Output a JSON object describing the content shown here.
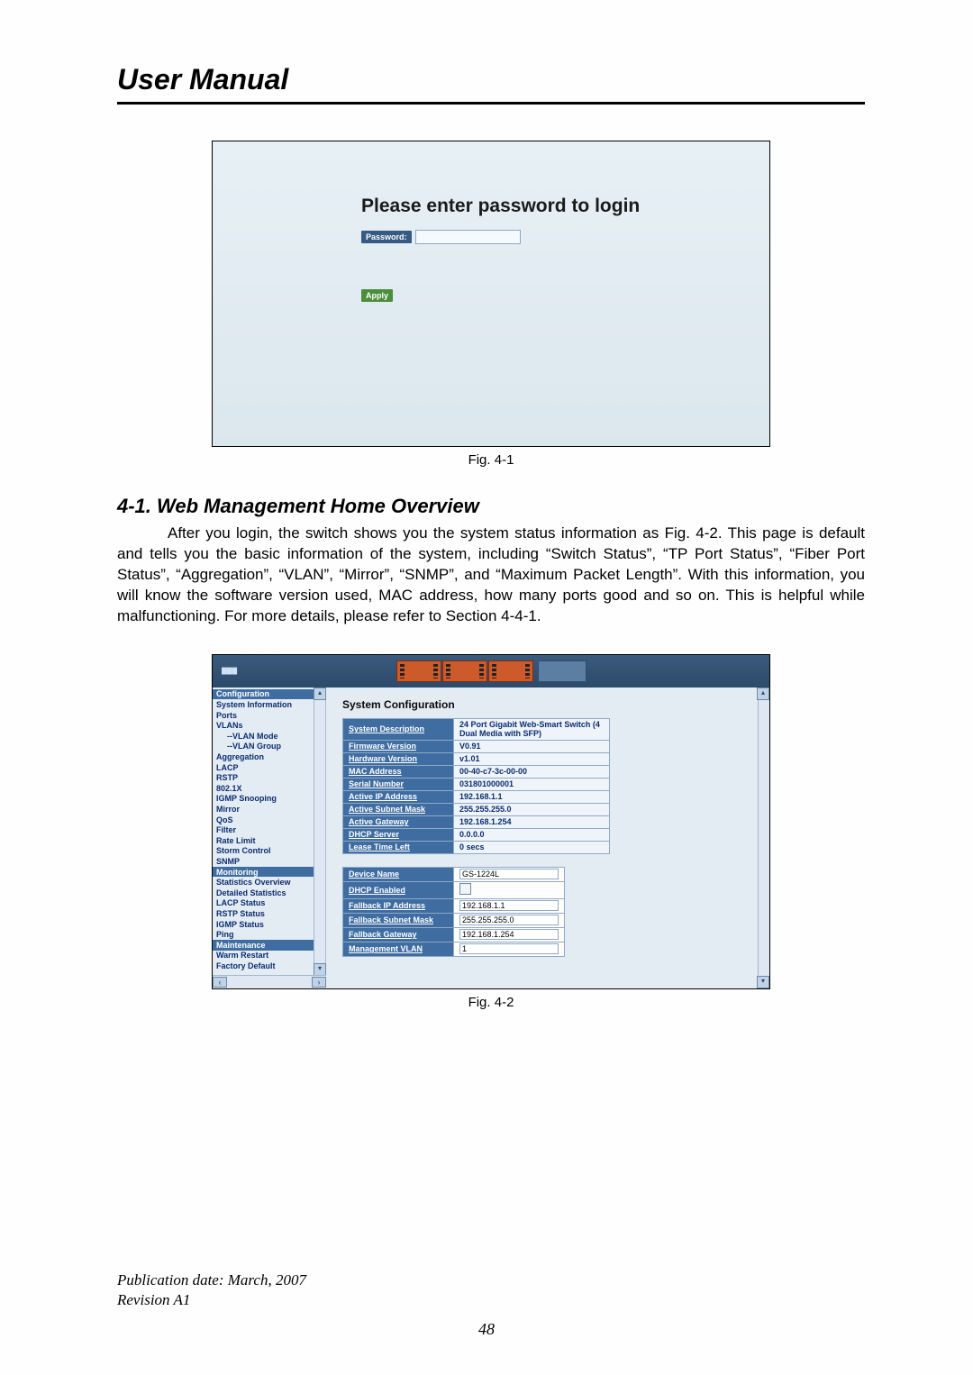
{
  "doc_title": "User Manual",
  "fig1": {
    "caption": "Fig. 4-1",
    "headline": "Please enter password to login",
    "password_label": "Password:",
    "apply_label": "Apply"
  },
  "section_heading": "4-1. Web Management Home Overview",
  "body_paragraph": "After you login, the switch shows you the system status information as Fig. 4-2. This page is default and tells you the basic information of the system, including “Switch Status”, “TP Port Status”, “Fiber Port Status”, “Aggregation”, “VLAN”, “Mirror”, “SNMP”, and “Maximum Packet Length”. With this information, you will know the software version used, MAC address, how many ports good and so on. This is helpful while malfunctioning. For more details, please refer to Section 4-4-1.",
  "fig2": {
    "caption": "Fig. 4-2",
    "panel_title": "System Configuration",
    "sidebar": [
      {
        "label": "Configuration",
        "cls": "header"
      },
      {
        "label": "System Information",
        "cls": ""
      },
      {
        "label": "Ports",
        "cls": ""
      },
      {
        "label": "VLANs",
        "cls": ""
      },
      {
        "label": "--VLAN Mode",
        "cls": "indent"
      },
      {
        "label": "--VLAN Group",
        "cls": "indent"
      },
      {
        "label": "Aggregation",
        "cls": ""
      },
      {
        "label": "LACP",
        "cls": ""
      },
      {
        "label": "RSTP",
        "cls": ""
      },
      {
        "label": "802.1X",
        "cls": ""
      },
      {
        "label": "IGMP Snooping",
        "cls": ""
      },
      {
        "label": "Mirror",
        "cls": ""
      },
      {
        "label": "QoS",
        "cls": ""
      },
      {
        "label": "Filter",
        "cls": ""
      },
      {
        "label": "Rate Limit",
        "cls": ""
      },
      {
        "label": "Storm Control",
        "cls": ""
      },
      {
        "label": "SNMP",
        "cls": ""
      },
      {
        "label": "Monitoring",
        "cls": "header"
      },
      {
        "label": "Statistics Overview",
        "cls": ""
      },
      {
        "label": "Detailed Statistics",
        "cls": ""
      },
      {
        "label": "LACP Status",
        "cls": ""
      },
      {
        "label": "RSTP Status",
        "cls": ""
      },
      {
        "label": "IGMP Status",
        "cls": ""
      },
      {
        "label": "Ping",
        "cls": ""
      },
      {
        "label": "Maintenance",
        "cls": "header"
      },
      {
        "label": "Warm Restart",
        "cls": ""
      },
      {
        "label": "Factory Default",
        "cls": ""
      }
    ],
    "table1": [
      {
        "k": "System Description",
        "v": "24 Port Gigabit Web-Smart Switch (4 Dual Media with SFP)",
        "big": true
      },
      {
        "k": "Firmware Version",
        "v": "V0.91"
      },
      {
        "k": "Hardware Version",
        "v": "v1.01"
      },
      {
        "k": "MAC Address",
        "v": "00-40-c7-3c-00-00"
      },
      {
        "k": "Serial Number",
        "v": "031801000001"
      },
      {
        "k": "Active IP Address",
        "v": "192.168.1.1"
      },
      {
        "k": "Active Subnet Mask",
        "v": "255.255.255.0"
      },
      {
        "k": "Active Gateway",
        "v": "192.168.1.254"
      },
      {
        "k": "DHCP Server",
        "v": "0.0.0.0"
      },
      {
        "k": "Lease Time Left",
        "v": "0 secs"
      }
    ],
    "table2": [
      {
        "k": "Device Name",
        "type": "input",
        "v": "GS-1224L"
      },
      {
        "k": "DHCP Enabled",
        "type": "checkbox",
        "v": ""
      },
      {
        "k": "Fallback IP Address",
        "type": "input",
        "v": "192.168.1.1"
      },
      {
        "k": "Fallback Subnet Mask",
        "type": "input",
        "v": "255.255.255.0"
      },
      {
        "k": "Fallback Gateway",
        "type": "input",
        "v": "192.168.1.254"
      },
      {
        "k": "Management VLAN",
        "type": "input",
        "v": "1"
      }
    ]
  },
  "footer": {
    "pub_date": "Publication date: March, 2007",
    "revision": "Revision A1",
    "page_number": "48"
  }
}
